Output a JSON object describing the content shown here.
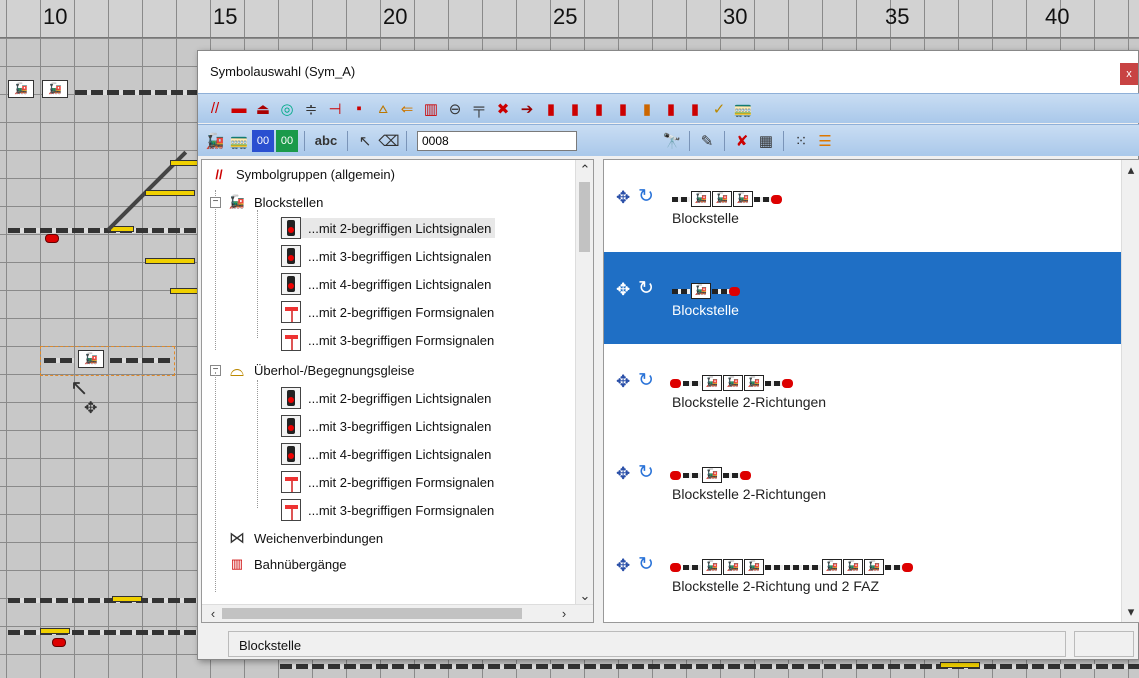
{
  "ruler": {
    "labels": [
      "10",
      "15",
      "20",
      "25",
      "30",
      "35",
      "40"
    ]
  },
  "dialog": {
    "title": "Symbolauswahl (Sym_A)",
    "close": "x",
    "toolbar2": {
      "abc_label": "abc",
      "code_value": "0008"
    },
    "tree": {
      "root_label": "Symbolgruppen (allgemein)",
      "groups": [
        {
          "label": "Blockstellen",
          "children": [
            "...mit 2-begriffigen Lichtsignalen",
            "...mit 3-begriffigen Lichtsignalen",
            "...mit 4-begriffigen Lichtsignalen",
            "...mit 2-begriffigen Formsignalen",
            "...mit 3-begriffigen Formsignalen"
          ]
        },
        {
          "label": "Überhol-/Begegnungsgleise",
          "children": [
            "...mit 2-begriffigen Lichtsignalen",
            "...mit 3-begriffigen Lichtsignalen",
            "...mit 4-begriffigen Lichtsignalen",
            "...mit 2-begriffigen Formsignalen",
            "...mit 3-begriffigen Formsignalen"
          ]
        }
      ],
      "more": [
        "Weichenverbindungen",
        "Bahnübergänge"
      ]
    },
    "results": [
      {
        "label": "Blockstelle",
        "selected": false
      },
      {
        "label": "Blockstelle",
        "selected": true
      },
      {
        "label": "Blockstelle 2-Richtungen",
        "selected": false
      },
      {
        "label": "Blockstelle 2-Richtungen",
        "selected": false
      },
      {
        "label": "Blockstelle 2-Richtung und 2 FAZ",
        "selected": false
      }
    ],
    "status_text": "Blockstelle",
    "colors": {
      "selection": "#1f6fc5",
      "toolbar": "#b9d3f0"
    }
  }
}
